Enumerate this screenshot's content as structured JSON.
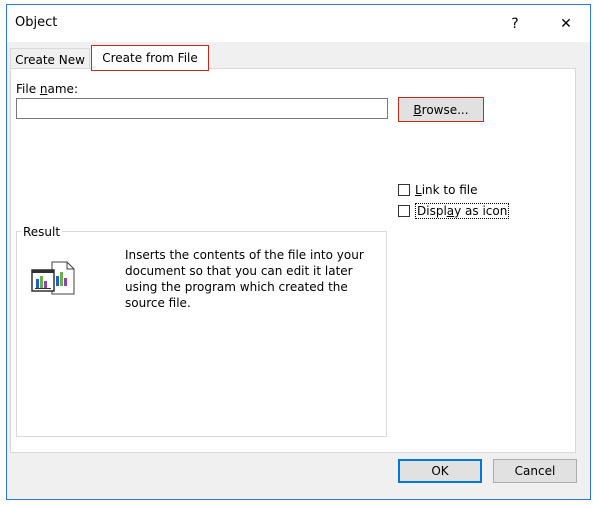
{
  "window": {
    "title": "Object",
    "help_glyph": "?",
    "close_glyph": "✕"
  },
  "tabs": [
    {
      "label": "Create New",
      "active": false
    },
    {
      "label": "Create from File",
      "active": true
    }
  ],
  "file": {
    "label_pre": "File ",
    "label_mnemonic": "n",
    "label_post": "ame:",
    "value": "",
    "placeholder": "",
    "browse_mnemonic": "B",
    "browse_post": "rowse..."
  },
  "options": {
    "link_mnemonic": "L",
    "link_post": "ink to file",
    "link_checked": false,
    "icon_pre": "Displ",
    "icon_mnemonic": "a",
    "icon_post": "y as icon",
    "icon_checked": false
  },
  "result": {
    "legend": "Result",
    "icon": "embedded-document-icon",
    "text": "Inserts the contents of the file into your document so that you can edit it later using the program which created the source file."
  },
  "buttons": {
    "ok": "OK",
    "cancel": "Cancel"
  },
  "colors": {
    "focus_red": "#c42b1c",
    "accent_blue": "#0078d7",
    "window_border": "#2b79d0"
  }
}
